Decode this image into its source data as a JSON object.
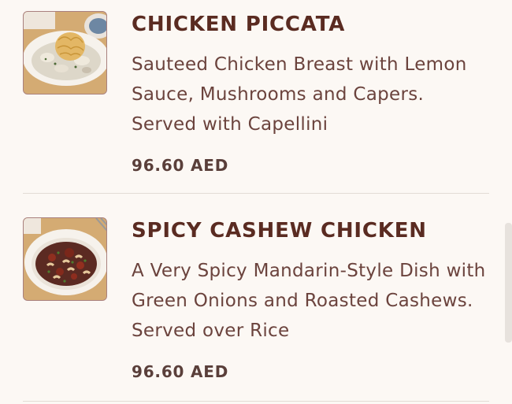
{
  "menu": {
    "items": [
      {
        "title": "CHICKEN PICCATA",
        "description": "Sauteed Chicken Breast with Lemon Sauce, Mushrooms and Capers. Served with Capellini",
        "price": "96.60 AED"
      },
      {
        "title": "SPICY CASHEW CHICKEN",
        "description": "A Very Spicy Mandarin-Style Dish with Green Onions and Roasted Cashews. Served over Rice",
        "price": "96.60 AED"
      }
    ]
  },
  "colors": {
    "background": "#fcf8f4",
    "title": "#5a2b21",
    "description": "#6b433d",
    "price": "#5a3f3a",
    "divider": "#e3dcd5",
    "thumb_border": "#a9807e"
  }
}
